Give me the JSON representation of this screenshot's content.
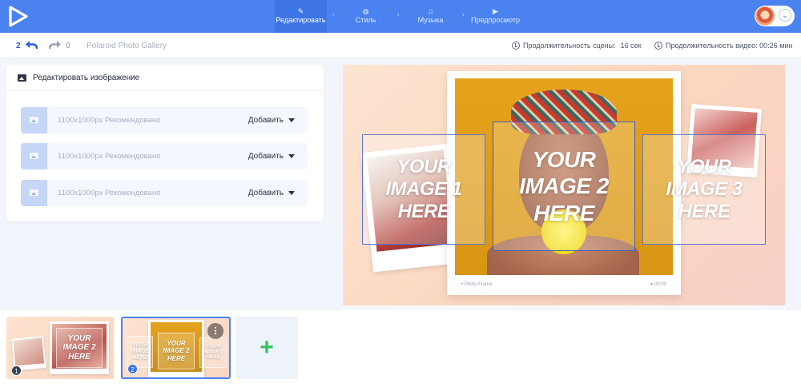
{
  "nav": {
    "steps": [
      {
        "label": "Редактировать",
        "icon": "pencil-icon",
        "active": true
      },
      {
        "label": "Стиль",
        "icon": "palette-icon",
        "active": false
      },
      {
        "label": "Музыка",
        "icon": "music-note-icon",
        "active": false
      },
      {
        "label": "Предпросмотр",
        "icon": "play-icon",
        "active": false
      }
    ],
    "separator": "›"
  },
  "toolbar": {
    "undo_count": "2",
    "redo_count": "0",
    "project_name": "Polaroid Photo Gallery",
    "scene_duration_label": "Продолжительность сцены:",
    "scene_duration_value": "16 сек",
    "video_duration_label": "Продолжительность видео: 00:26 мин"
  },
  "edit_panel": {
    "title": "Редактировать изображение",
    "rows": [
      {
        "hint": "1100x1000px Рекомендовано",
        "action": "Добавить"
      },
      {
        "hint": "1100x1000px Рекомендовано",
        "action": "Добавить"
      },
      {
        "hint": "1100x1000px Рекомендовано",
        "action": "Добавить"
      }
    ]
  },
  "preview": {
    "caption": "Photo Frame",
    "caption_time": "00:00",
    "placeholders": [
      {
        "line1": "YOUR",
        "line2": "IMAGE 1",
        "line3": "HERE"
      },
      {
        "line1": "YOUR",
        "line2": "IMAGE 2",
        "line3": "HERE"
      },
      {
        "line1": "YOUR",
        "line2": "IMAGE 3",
        "line3": "HERE"
      }
    ]
  },
  "timeline": {
    "scenes": [
      {
        "number": "1",
        "placeholder_line1": "YOUR",
        "placeholder_line2": "IMAGE 2",
        "placeholder_line3": "HERE"
      },
      {
        "number": "2",
        "placeholder_line1": "YOUR",
        "placeholder_line2": "IMAGE 2",
        "placeholder_line3": "HERE",
        "more": "⋮"
      }
    ],
    "add_label": "+"
  },
  "colors": {
    "accent": "#4a82f0",
    "add_green": "#35c25f"
  }
}
